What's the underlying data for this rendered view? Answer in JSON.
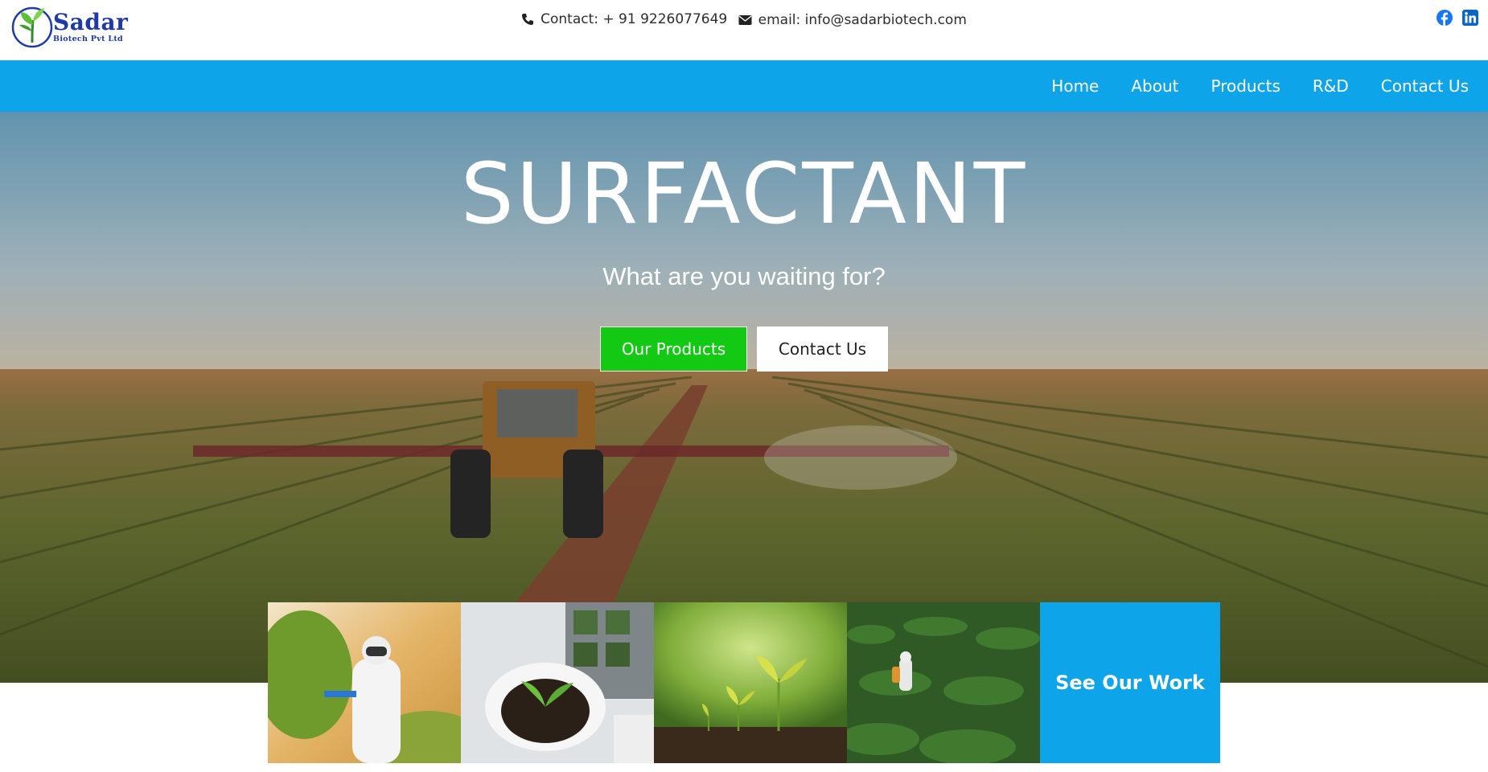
{
  "brand": {
    "name": "Sadar",
    "tagline": "Biotech Pvt Ltd"
  },
  "contact": {
    "phone_label": "Contact: + 91 9226077649",
    "email_label": "email: info@sadarbiotech.com"
  },
  "social": [
    {
      "icon": "facebook-icon",
      "color": "#1877f2"
    },
    {
      "icon": "linkedin-icon",
      "color": "#0a66c2"
    }
  ],
  "nav": {
    "items": [
      "Home",
      "About",
      "Products",
      "R&D",
      "Contact Us"
    ]
  },
  "hero": {
    "title": "SURFACTANT",
    "subtitle": "What are you waiting for?",
    "primary_button": "Our Products",
    "secondary_button": "Contact Us"
  },
  "gallery": {
    "cta": "See Our Work"
  },
  "colors": {
    "accent": "#0ea4e9",
    "primary_button": "#13c913",
    "brand_text": "#1f3aa6"
  }
}
